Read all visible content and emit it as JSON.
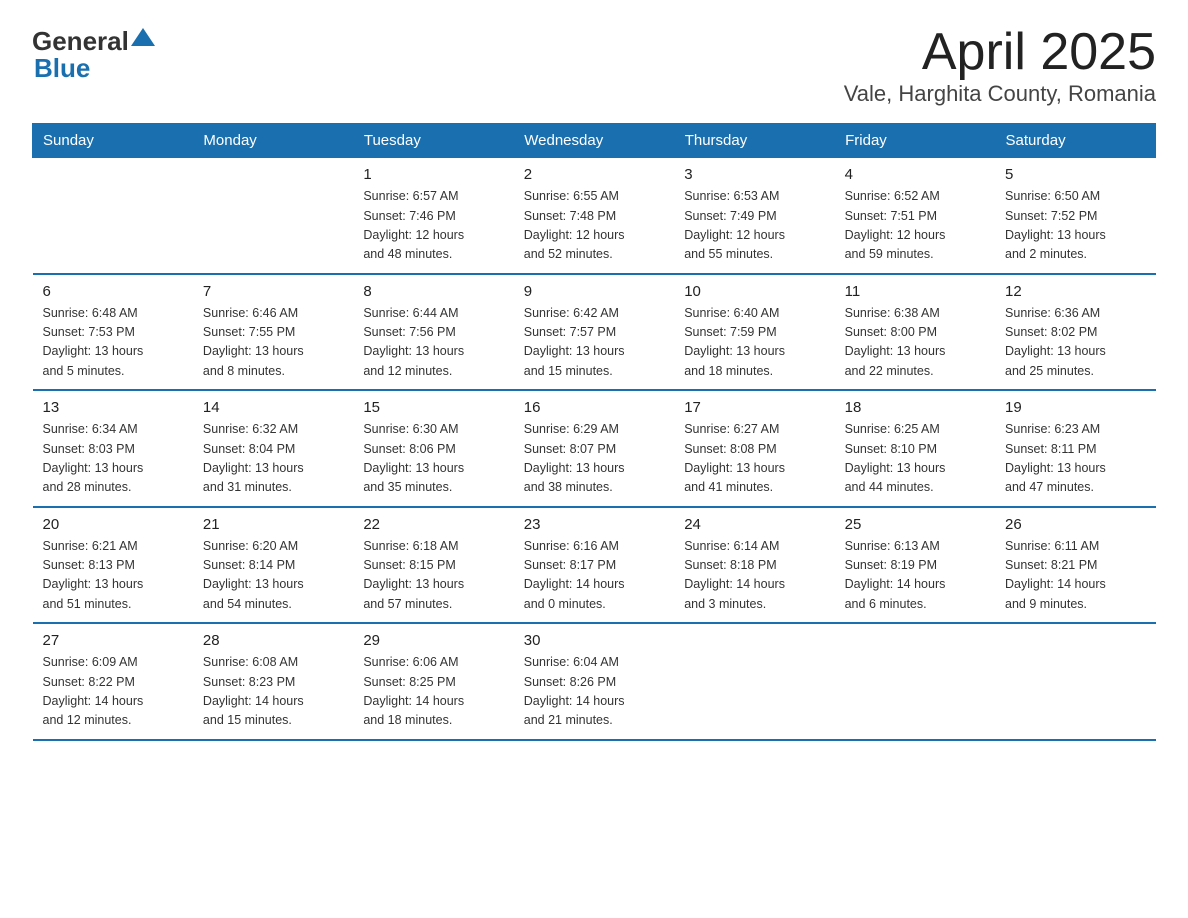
{
  "logo": {
    "general": "General",
    "blue": "Blue",
    "subtitle": ""
  },
  "title": "April 2025",
  "subtitle": "Vale, Harghita County, Romania",
  "days_of_week": [
    "Sunday",
    "Monday",
    "Tuesday",
    "Wednesday",
    "Thursday",
    "Friday",
    "Saturday"
  ],
  "weeks": [
    [
      {
        "day": "",
        "info": ""
      },
      {
        "day": "",
        "info": ""
      },
      {
        "day": "1",
        "info": "Sunrise: 6:57 AM\nSunset: 7:46 PM\nDaylight: 12 hours\nand 48 minutes."
      },
      {
        "day": "2",
        "info": "Sunrise: 6:55 AM\nSunset: 7:48 PM\nDaylight: 12 hours\nand 52 minutes."
      },
      {
        "day": "3",
        "info": "Sunrise: 6:53 AM\nSunset: 7:49 PM\nDaylight: 12 hours\nand 55 minutes."
      },
      {
        "day": "4",
        "info": "Sunrise: 6:52 AM\nSunset: 7:51 PM\nDaylight: 12 hours\nand 59 minutes."
      },
      {
        "day": "5",
        "info": "Sunrise: 6:50 AM\nSunset: 7:52 PM\nDaylight: 13 hours\nand 2 minutes."
      }
    ],
    [
      {
        "day": "6",
        "info": "Sunrise: 6:48 AM\nSunset: 7:53 PM\nDaylight: 13 hours\nand 5 minutes."
      },
      {
        "day": "7",
        "info": "Sunrise: 6:46 AM\nSunset: 7:55 PM\nDaylight: 13 hours\nand 8 minutes."
      },
      {
        "day": "8",
        "info": "Sunrise: 6:44 AM\nSunset: 7:56 PM\nDaylight: 13 hours\nand 12 minutes."
      },
      {
        "day": "9",
        "info": "Sunrise: 6:42 AM\nSunset: 7:57 PM\nDaylight: 13 hours\nand 15 minutes."
      },
      {
        "day": "10",
        "info": "Sunrise: 6:40 AM\nSunset: 7:59 PM\nDaylight: 13 hours\nand 18 minutes."
      },
      {
        "day": "11",
        "info": "Sunrise: 6:38 AM\nSunset: 8:00 PM\nDaylight: 13 hours\nand 22 minutes."
      },
      {
        "day": "12",
        "info": "Sunrise: 6:36 AM\nSunset: 8:02 PM\nDaylight: 13 hours\nand 25 minutes."
      }
    ],
    [
      {
        "day": "13",
        "info": "Sunrise: 6:34 AM\nSunset: 8:03 PM\nDaylight: 13 hours\nand 28 minutes."
      },
      {
        "day": "14",
        "info": "Sunrise: 6:32 AM\nSunset: 8:04 PM\nDaylight: 13 hours\nand 31 minutes."
      },
      {
        "day": "15",
        "info": "Sunrise: 6:30 AM\nSunset: 8:06 PM\nDaylight: 13 hours\nand 35 minutes."
      },
      {
        "day": "16",
        "info": "Sunrise: 6:29 AM\nSunset: 8:07 PM\nDaylight: 13 hours\nand 38 minutes."
      },
      {
        "day": "17",
        "info": "Sunrise: 6:27 AM\nSunset: 8:08 PM\nDaylight: 13 hours\nand 41 minutes."
      },
      {
        "day": "18",
        "info": "Sunrise: 6:25 AM\nSunset: 8:10 PM\nDaylight: 13 hours\nand 44 minutes."
      },
      {
        "day": "19",
        "info": "Sunrise: 6:23 AM\nSunset: 8:11 PM\nDaylight: 13 hours\nand 47 minutes."
      }
    ],
    [
      {
        "day": "20",
        "info": "Sunrise: 6:21 AM\nSunset: 8:13 PM\nDaylight: 13 hours\nand 51 minutes."
      },
      {
        "day": "21",
        "info": "Sunrise: 6:20 AM\nSunset: 8:14 PM\nDaylight: 13 hours\nand 54 minutes."
      },
      {
        "day": "22",
        "info": "Sunrise: 6:18 AM\nSunset: 8:15 PM\nDaylight: 13 hours\nand 57 minutes."
      },
      {
        "day": "23",
        "info": "Sunrise: 6:16 AM\nSunset: 8:17 PM\nDaylight: 14 hours\nand 0 minutes."
      },
      {
        "day": "24",
        "info": "Sunrise: 6:14 AM\nSunset: 8:18 PM\nDaylight: 14 hours\nand 3 minutes."
      },
      {
        "day": "25",
        "info": "Sunrise: 6:13 AM\nSunset: 8:19 PM\nDaylight: 14 hours\nand 6 minutes."
      },
      {
        "day": "26",
        "info": "Sunrise: 6:11 AM\nSunset: 8:21 PM\nDaylight: 14 hours\nand 9 minutes."
      }
    ],
    [
      {
        "day": "27",
        "info": "Sunrise: 6:09 AM\nSunset: 8:22 PM\nDaylight: 14 hours\nand 12 minutes."
      },
      {
        "day": "28",
        "info": "Sunrise: 6:08 AM\nSunset: 8:23 PM\nDaylight: 14 hours\nand 15 minutes."
      },
      {
        "day": "29",
        "info": "Sunrise: 6:06 AM\nSunset: 8:25 PM\nDaylight: 14 hours\nand 18 minutes."
      },
      {
        "day": "30",
        "info": "Sunrise: 6:04 AM\nSunset: 8:26 PM\nDaylight: 14 hours\nand 21 minutes."
      },
      {
        "day": "",
        "info": ""
      },
      {
        "day": "",
        "info": ""
      },
      {
        "day": "",
        "info": ""
      }
    ]
  ]
}
